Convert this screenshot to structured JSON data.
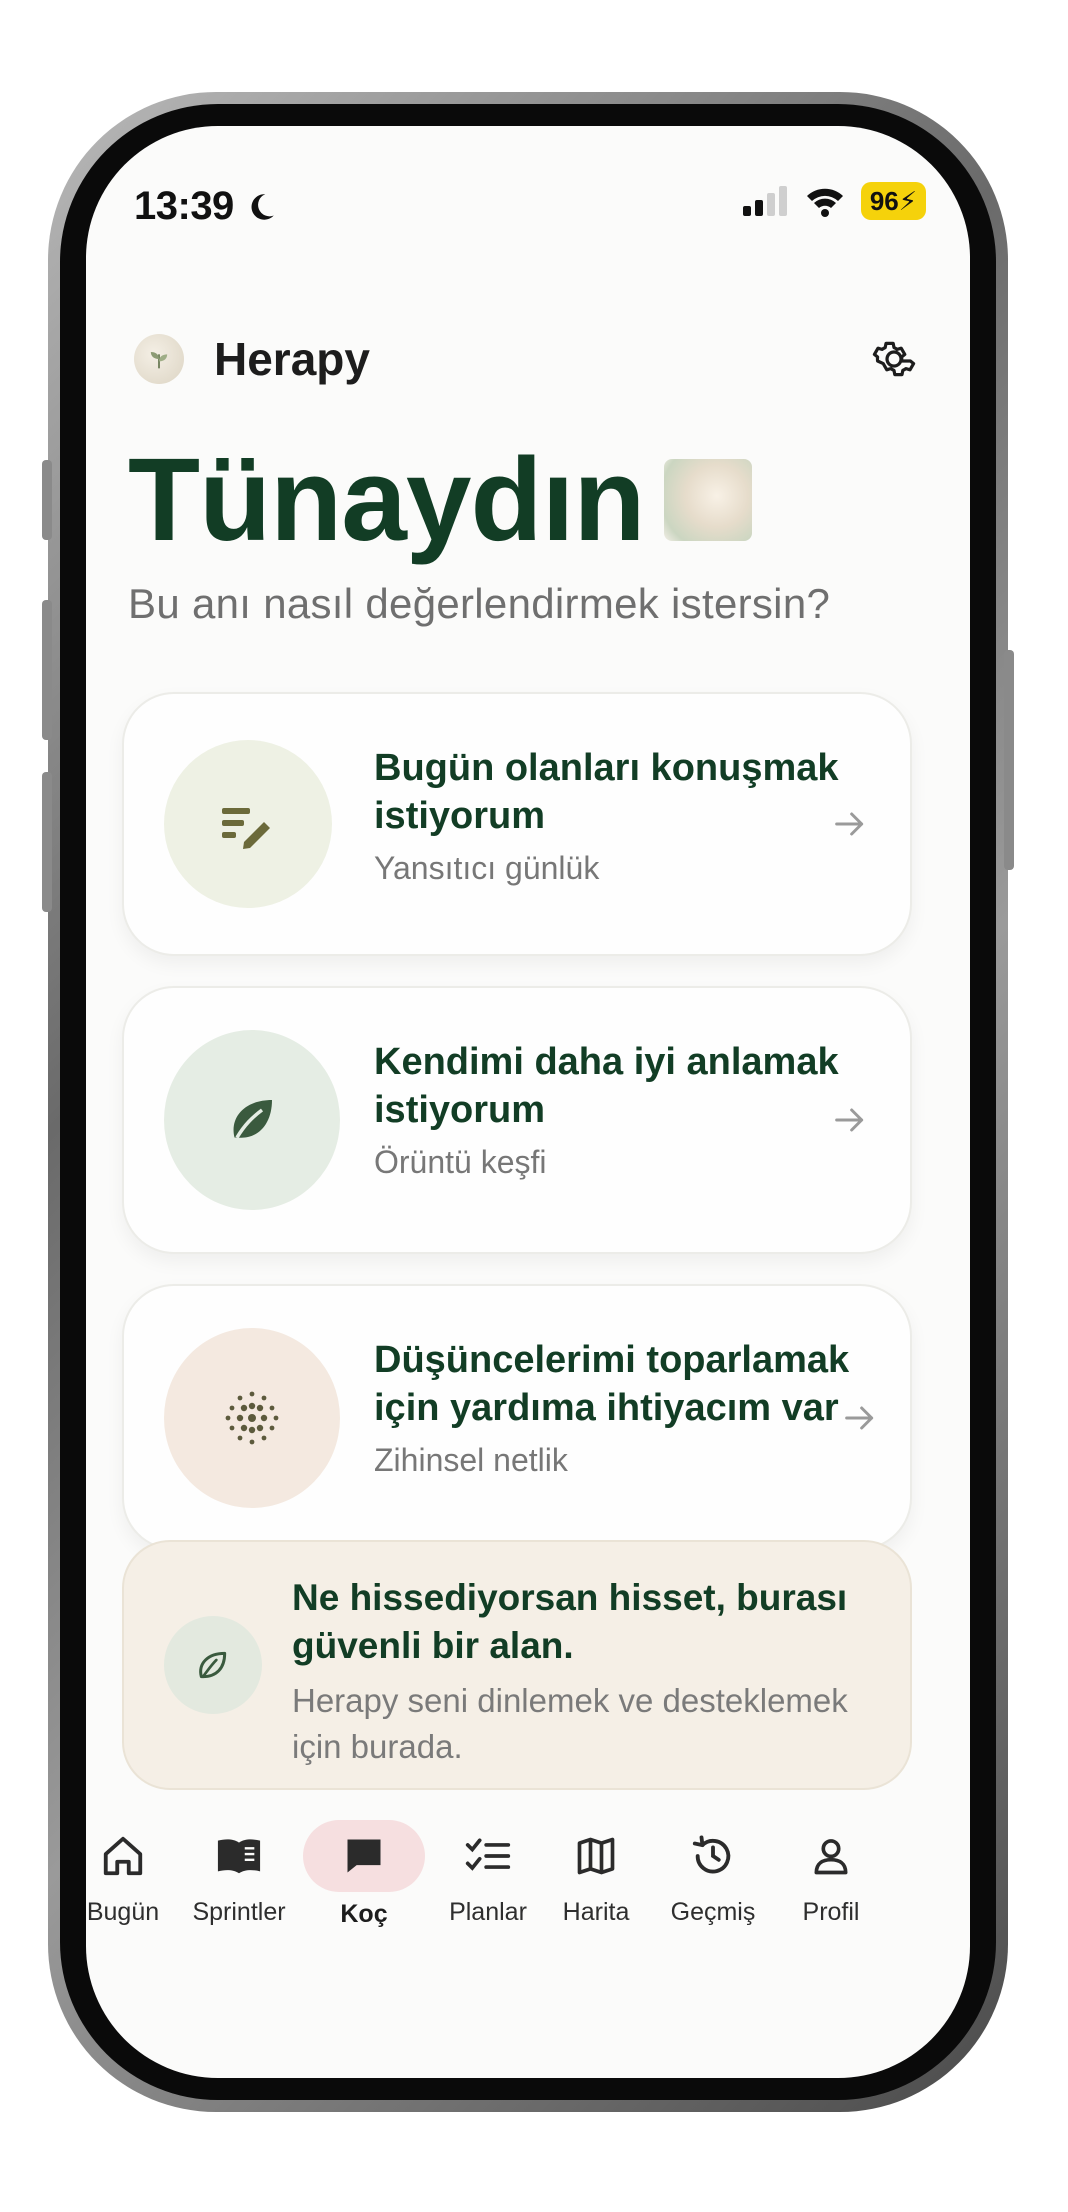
{
  "status": {
    "time": "13:39",
    "battery": "96"
  },
  "header": {
    "app_name": "Herapy"
  },
  "greeting": {
    "title": "Tünaydın",
    "subtitle": "Bu anı nasıl değerlendirmek istersin?"
  },
  "options": [
    {
      "title": "Bugün olanları konuşmak istiyorum",
      "subtitle": "Yansıtıcı günlük",
      "icon": "notes-edit-icon",
      "circle_color": "#eef1e4"
    },
    {
      "title": "Kendimi daha iyi anlamak istiyorum",
      "subtitle": "Örüntü keşfi",
      "icon": "leaf-icon",
      "circle_color": "#e5ede4"
    },
    {
      "title": "Düşüncelerimi toparlamak için yardıma ihtiyacım var",
      "subtitle": "Zihinsel netlik",
      "icon": "dots-grid-icon",
      "circle_color": "#f4e9e0"
    }
  ],
  "note": {
    "title": "Ne hissediyorsan hisset, burası güvenli bir alan.",
    "body": "Herapy seni dinlemek ve desteklemek için burada."
  },
  "tabs": [
    {
      "label": "Bugün",
      "icon": "home-icon"
    },
    {
      "label": "Sprintler",
      "icon": "book-icon"
    },
    {
      "label": "Koç",
      "icon": "chat-icon",
      "active": true
    },
    {
      "label": "Planlar",
      "icon": "checklist-icon"
    },
    {
      "label": "Harita",
      "icon": "map-icon"
    },
    {
      "label": "Geçmiş",
      "icon": "history-icon"
    },
    {
      "label": "Profil",
      "icon": "user-icon"
    }
  ],
  "colors": {
    "brand_green": "#123d25",
    "active_tab_bg": "#f6dfe0",
    "battery": "#f5d20b"
  }
}
